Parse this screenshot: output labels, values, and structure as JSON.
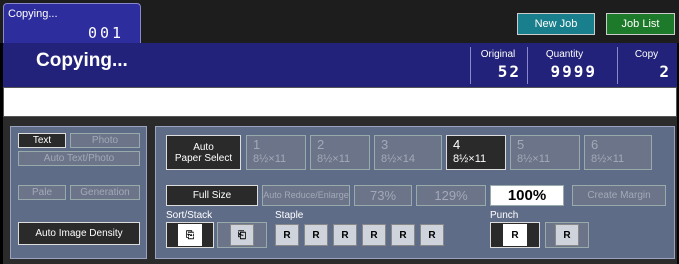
{
  "topbar": {
    "tab_label": "Copying...",
    "tab_number": "001",
    "new_job": "New Job",
    "job_list": "Job List"
  },
  "status": {
    "title": "Copying...",
    "original_label": "Original",
    "original_value": "52",
    "quantity_label": "Quantity",
    "quantity_value": "9999",
    "copy_label": "Copy",
    "copy_value": "2"
  },
  "message": "",
  "left": {
    "text": "Text",
    "photo": "Photo",
    "auto_text_photo": "Auto Text/Photo",
    "pale": "Pale",
    "generation": "Generation",
    "auto_density": "Auto Image Density"
  },
  "paper": {
    "auto": "Auto",
    "paper_select": "Paper Select",
    "trays": [
      {
        "num": "1",
        "size": "8½×11"
      },
      {
        "num": "2",
        "size": "8½×11"
      },
      {
        "num": "3",
        "size": "8½×14"
      },
      {
        "num": "4",
        "size": "8½×11"
      },
      {
        "num": "5",
        "size": "8½×11"
      },
      {
        "num": "6",
        "size": "8½×11"
      }
    ]
  },
  "ratio": {
    "full_size": "Full Size",
    "auto_reduce": "Auto Reduce/Enlarge",
    "r73": "73%",
    "r129": "129%",
    "current": "100%",
    "create_margin": "Create Margin"
  },
  "finishing": {
    "sort_stack": "Sort/Stack",
    "staple": "Staple",
    "punch": "Punch"
  },
  "colors": {
    "tab": "#2d2d9d",
    "status_bg": "#22227a",
    "panel": "#5f6c88",
    "new_job": "#1a7f8c",
    "job_list": "#1d7a2a"
  }
}
